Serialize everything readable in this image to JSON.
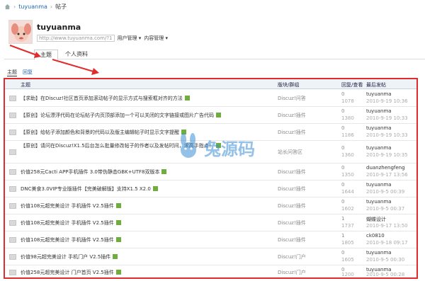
{
  "breadcrumb": {
    "user": "tuyuanma",
    "section": "帖子"
  },
  "profile": {
    "name": "tuyuanma",
    "url": "http://www.tuyuanma.com/?1",
    "menu_user": "用户管理",
    "menu_content": "内容管理"
  },
  "tabs": [
    {
      "label": "主题"
    },
    {
      "label": "个人资料"
    }
  ],
  "subnav": {
    "first": "主题",
    "second": "回复"
  },
  "table": {
    "headers": {
      "subject": "主题",
      "forum": "版块/群组",
      "reply_view": "回复/查看",
      "last_post": "最后发帖"
    },
    "rows": [
      {
        "title": "【求助】在Discuz!社区首页添加滚动帖子的显示方式与搜索框对齐的方法",
        "forum": "Discuz!问答",
        "replies": "0",
        "views": "1078",
        "last_user": "tuyuanma",
        "last_time": "2010-9-19 10:36"
      },
      {
        "title": "【原创】论坛漂浮代码在论坛帖子内页顶部添加一个可以关闭的文字链接或图片广告代码",
        "forum": "Discuz!插件",
        "replies": "0",
        "views": "1380",
        "last_user": "tuyuanma",
        "last_time": "2010-9-19 10:33"
      },
      {
        "title": "【原创】给帖子添加颜色和背景的代码以及版主编辑帖子时显示文字提醒",
        "forum": "Discuz!插件",
        "replies": "0",
        "views": "1186",
        "last_user": "tuyuanma",
        "last_time": "2010-9-19 10:33"
      },
      {
        "title": "【原创】请问在Discuz!X1.5后台怎么批量修改帖子的作者以及发帖时间，求高手指点！",
        "forum": "站长问答区",
        "replies": "0",
        "views": "1360",
        "last_user": "tuyuanma",
        "last_time": "2010-9-19 10:35"
      },
      {
        "title": "价值258元Cacti APP手机插件 3.0带伪静态GBK+UTF8双版本",
        "forum": "Discuz!插件",
        "replies": "0",
        "views": "1350",
        "last_user": "duanzhengfeng",
        "last_time": "2010-9-17 13:56"
      },
      {
        "title": "DNC美食3.0VIP专业版插件【完美破解版】支持X1.5 X2.0",
        "forum": "Discuz!插件",
        "replies": "0",
        "views": "1644",
        "last_user": "tuyuanma",
        "last_time": "2010-9-5 00:39"
      },
      {
        "title": "价值108元超完美设计 手机插件 V2.5插件",
        "forum": "Discuz!插件",
        "replies": "0",
        "views": "1602",
        "last_user": "tuyuanma",
        "last_time": "2010-9-5 00:37"
      },
      {
        "title": "价值108元超完美设计 手机插件 V2.5插件",
        "forum": "Discuz!插件",
        "replies": "1",
        "views": "1737",
        "last_user": "蝴蝶设计",
        "last_time": "2010-9-17 13:50"
      },
      {
        "title": "价值108元超完美设计 手机插件 V2.5插件",
        "forum": "Discuz!插件",
        "replies": "1",
        "views": "1805",
        "last_user": "ck0810",
        "last_time": "2010-9-18 09:17"
      },
      {
        "title": "价值98元超完美设计 手机门户 V2.5插件",
        "forum": "Discuz!门户",
        "replies": "0",
        "views": "1605",
        "last_user": "tuyuanma",
        "last_time": "2010-9-5 00:30"
      },
      {
        "title": "价值258元超完美设计 门户首页 V2.5插件",
        "forum": "Discuz!门户",
        "replies": "0",
        "views": "1200",
        "last_user": "tuyuanma",
        "last_time": "2010-9-5 00:28"
      }
    ]
  },
  "watermark": "兔源码",
  "colors": {
    "highlight_frame": "#e02c2c",
    "link": "#2266aa",
    "attachment": "#6fae3d"
  }
}
